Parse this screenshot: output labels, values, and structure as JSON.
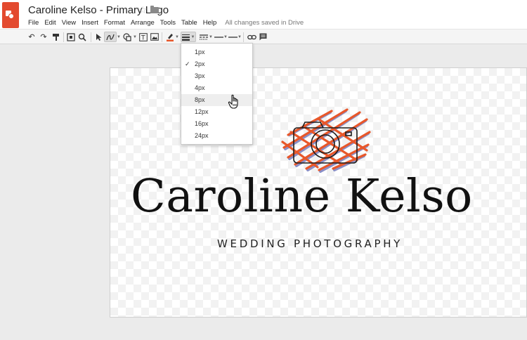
{
  "app": {
    "doc_title": "Caroline Kelso - Primary Logo",
    "save_status": "All changes saved in Drive",
    "icons": {
      "logo": "drawings-logo-icon",
      "star": "star-icon",
      "folder": "folder-icon"
    },
    "brand_color": "#e34a2f"
  },
  "menubar": {
    "items": [
      {
        "label": "File"
      },
      {
        "label": "Edit"
      },
      {
        "label": "View"
      },
      {
        "label": "Insert"
      },
      {
        "label": "Format"
      },
      {
        "label": "Arrange"
      },
      {
        "label": "Tools"
      },
      {
        "label": "Table"
      },
      {
        "label": "Help"
      }
    ]
  },
  "toolbar": {
    "icons": [
      "undo-icon",
      "redo-icon",
      "paint-format-icon",
      "fit-icon",
      "zoom-icon",
      "select-icon",
      "line-icon",
      "shape-icon",
      "text-box-icon",
      "image-icon",
      "line-color-icon",
      "line-weight-icon",
      "line-dash-icon",
      "line-start-icon",
      "line-end-icon",
      "link-icon",
      "comment-icon"
    ],
    "active": "line-weight-icon",
    "line_color": "#e8572a"
  },
  "line_weight_menu": {
    "options": [
      {
        "label": "1px",
        "checked": false
      },
      {
        "label": "2px",
        "checked": true
      },
      {
        "label": "3px",
        "checked": false
      },
      {
        "label": "4px",
        "checked": false
      },
      {
        "label": "8px",
        "checked": false,
        "hovered": true
      },
      {
        "label": "12px",
        "checked": false
      },
      {
        "label": "16px",
        "checked": false
      },
      {
        "label": "24px",
        "checked": false
      }
    ],
    "check_glyph": "✓"
  },
  "canvas": {
    "brand_name": "Caroline Kelso",
    "tagline": "WEDDING PHOTOGRAPHY",
    "scribble_colors": [
      "#e8572a",
      "#8a8fc7"
    ]
  }
}
